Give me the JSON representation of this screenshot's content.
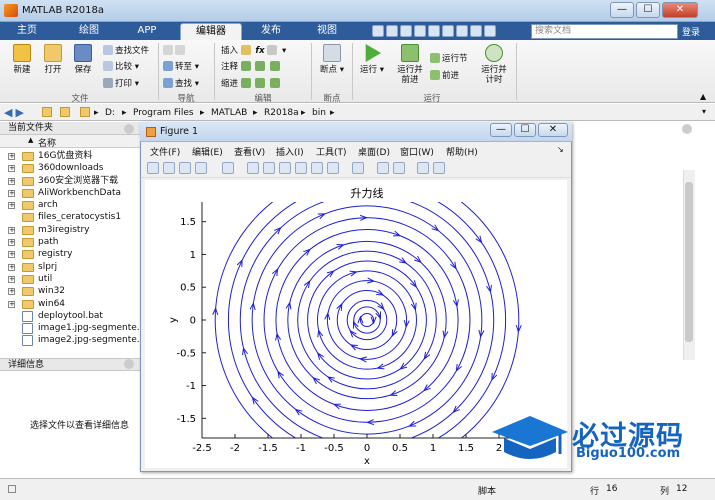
{
  "window": {
    "title": "MATLAB R2018a",
    "buttons": [
      "—",
      "☐",
      "✕"
    ]
  },
  "tabs": [
    "主页",
    "绘图",
    "APP",
    "编辑器",
    "发布",
    "视图"
  ],
  "active_tab": "编辑器",
  "search": {
    "placeholder": "搜索文档"
  },
  "login": "登录",
  "ribbon": {
    "file": {
      "new": "新建",
      "open": "打开",
      "save": "保存",
      "find_files": "查找文件",
      "compare": "比较",
      "print": "打印",
      "group": "文件"
    },
    "navigate": {
      "goto": "转至",
      "find": "查找",
      "group": "导航"
    },
    "edit": {
      "insert": "插入",
      "comment": "注释",
      "indent": "缩进",
      "group": "编辑"
    },
    "breakpoints": {
      "label": "断点",
      "group": "断点"
    },
    "run": {
      "run": "运行",
      "run_advance": "运行并\n前进",
      "run_section": "运行节",
      "advance": "前进",
      "run_time": "运行并\n计时",
      "group": "运行"
    }
  },
  "address": [
    "D:",
    "Program Files",
    "MATLAB",
    "R2018a",
    "bin"
  ],
  "file_panel": {
    "title": "当前文件夹",
    "col_name": "名称",
    "items": [
      {
        "name": "16G优盘资料",
        "type": "folder",
        "expand": "+"
      },
      {
        "name": "360downloads",
        "type": "folder",
        "expand": "+"
      },
      {
        "name": "360安全浏览器下载",
        "type": "folder",
        "expand": "+"
      },
      {
        "name": "AliWorkbenchData",
        "type": "folder",
        "expand": "+"
      },
      {
        "name": "arch",
        "type": "folder",
        "expand": "+"
      },
      {
        "name": "files_ceratocystis1",
        "type": "folder",
        "expand": ""
      },
      {
        "name": "m3iregistry",
        "type": "folder",
        "expand": "+"
      },
      {
        "name": "path",
        "type": "folder",
        "expand": "+"
      },
      {
        "name": "registry",
        "type": "folder",
        "expand": "+"
      },
      {
        "name": "slprj",
        "type": "folder",
        "expand": "+"
      },
      {
        "name": "util",
        "type": "folder",
        "expand": "+"
      },
      {
        "name": "win32",
        "type": "folder",
        "expand": "+"
      },
      {
        "name": "win64",
        "type": "folder",
        "expand": "+"
      },
      {
        "name": "deploytool.bat",
        "type": "file",
        "expand": ""
      },
      {
        "name": "image1.jpg-segmente...",
        "type": "file",
        "expand": ""
      },
      {
        "name": "image2.jpg-segmente...",
        "type": "file",
        "expand": ""
      }
    ]
  },
  "details": {
    "title": "详细信息",
    "message": "选择文件以查看详细信息"
  },
  "figure": {
    "title": "Figure 1",
    "menu": [
      "文件(F)",
      "编辑(E)",
      "查看(V)",
      "插入(I)",
      "工具(T)",
      "桌面(D)",
      "窗口(W)",
      "帮助(H)"
    ]
  },
  "status": {
    "script": "脚本",
    "row_label": "行",
    "row": "16",
    "col_label": "列",
    "col": "12"
  },
  "watermark": {
    "text": "必过源码",
    "url": "Biguo100.com"
  },
  "chart_data": {
    "type": "streamline",
    "title": "升力线",
    "xlabel": "x",
    "ylabel": "y",
    "xlim": [
      -2.5,
      2.5
    ],
    "ylim": [
      -1.8,
      1.8
    ],
    "xticks": [
      -2.5,
      -2,
      -1.5,
      -1,
      -0.5,
      0,
      0.5,
      1,
      1.5,
      2
    ],
    "yticks": [
      -1.5,
      -1,
      -0.5,
      0,
      0.5,
      1,
      1.5
    ],
    "center": [
      0,
      0
    ],
    "circle_radii": [
      0.1,
      0.2,
      0.3,
      0.45,
      0.6,
      0.75,
      0.9,
      1.05,
      1.2,
      1.38,
      1.56,
      1.74,
      1.92,
      2.1,
      2.3
    ],
    "rotation": "clockwise",
    "color": "#1f1fd8"
  }
}
